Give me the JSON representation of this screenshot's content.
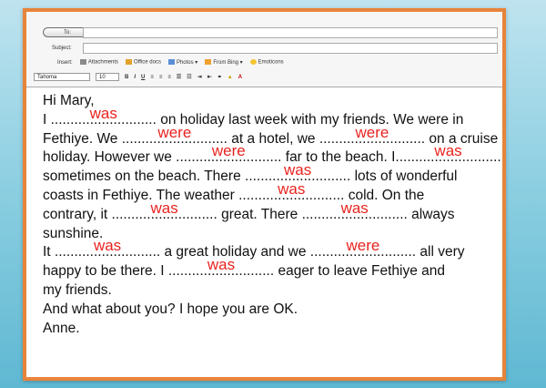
{
  "header": {
    "to_label": "To:",
    "subject_label": "Subject:",
    "insert_label": "Insert:",
    "insert_items": [
      "Attachments",
      "Office docs",
      "Photos ▾",
      "From Bing ▾",
      "Emoticons"
    ],
    "font_name": "Tahoma",
    "font_size": "10"
  },
  "letter": {
    "greeting": "Hi Mary,",
    "l1a": "I ",
    "l1d": "...........................",
    "l1ans": "was",
    "l1b": " on holiday last week with my friends. We were in",
    "l2a": "Fethiye. We ",
    "l2d": "...........................",
    "l2ans": "were",
    "l2b": " at a hotel, we ",
    "l2d2": "...........................",
    "l2ans2": "were",
    "l2c": " on a cruise",
    "l3a": "holiday. However we ",
    "l3d": "...........................",
    "l3ans": "were",
    "l3b": " far to the beach. I",
    "l3d2": "...........................",
    "l3ans2": "was",
    "l4a": "sometimes on the beach. There ",
    "l4d": "...........................",
    "l4ans": "was",
    "l4b": " lots of wonderful",
    "l5a": "coasts in Fethiye. The weather ",
    "l5d": "...........................",
    "l5ans": "was",
    "l5b": " cold. On the",
    "l6a": "contrary, it ",
    "l6d": "...........................",
    "l6ans": "was",
    "l6b": " great. There ",
    "l6d2": "...........................",
    "l6ans2": "was",
    "l6c": " always",
    "l7": "sunshine.",
    "l8a": "It ",
    "l8d": "...........................",
    "l8ans": "was",
    "l8b": " a great holiday and we ",
    "l8d2": "...........................",
    "l8ans2": "were",
    "l8c": " all very",
    "l9a": "happy to be there. I ",
    "l9d": "...........................",
    "l9ans": "was",
    "l9b": " eager to leave Fethiye and",
    "l10": "my friends.",
    "l11": "And what about you? I hope you are OK.",
    "l12": "Anne."
  },
  "colors": {
    "frame_border": "#e8843a",
    "answer": "#e8231f"
  }
}
